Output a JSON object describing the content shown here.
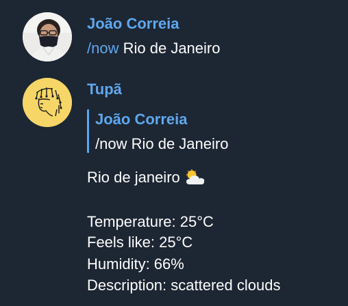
{
  "messages": [
    {
      "sender": "João Correia",
      "avatar": "user-photo-avatar",
      "command": "/now",
      "text": "Rio de Janeiro"
    },
    {
      "sender": "Tupã",
      "avatar": "native-headdress-avatar",
      "reply": {
        "sender": "João Correia",
        "text": "/now Rio de Janeiro"
      },
      "city_line": "Rio de janeiro",
      "weather_icon": "sun-behind-cloud-icon",
      "details": [
        "Temperature: 25°C",
        "Feels like: 25°C",
        "Humidity: 66%",
        "Description: scattered clouds"
      ]
    }
  ],
  "colors": {
    "background": "#1d2633",
    "accent": "#5fa8f0",
    "text": "#ffffff",
    "bot_avatar_bg": "#f6d667"
  }
}
